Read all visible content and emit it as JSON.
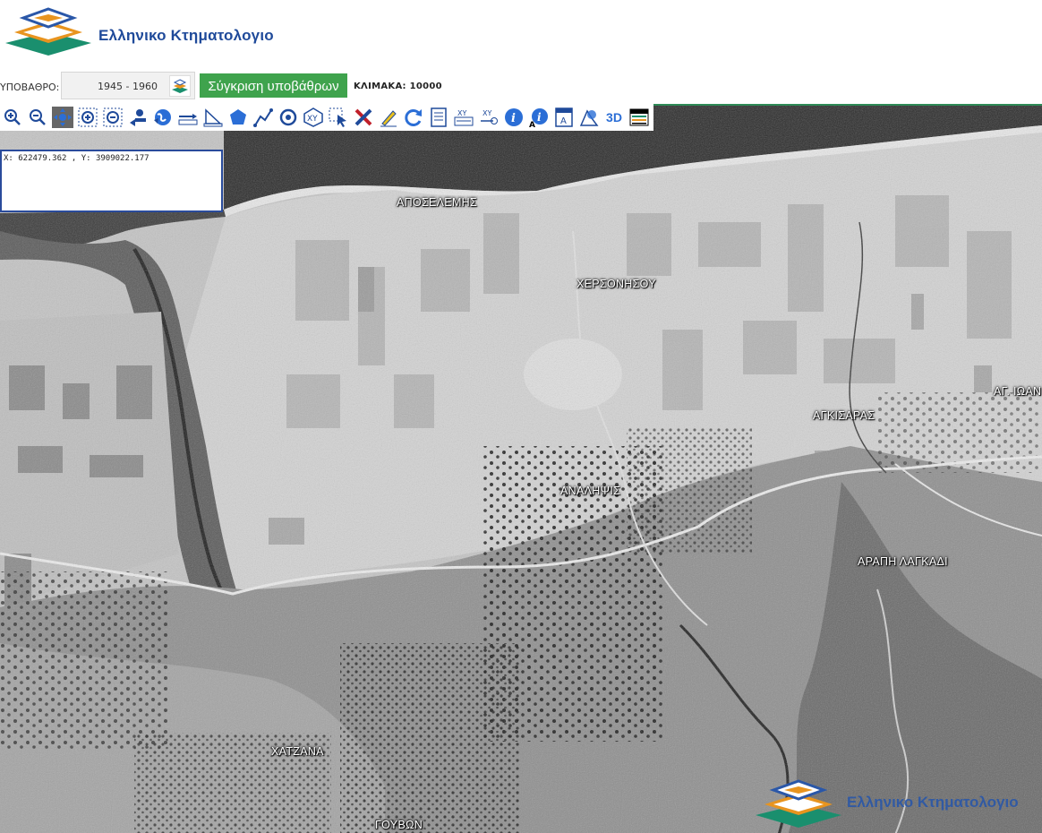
{
  "header": {
    "logo_text": "Ελληνικο Κτηματολογιο"
  },
  "controls": {
    "basemap_label": "ΥΠΟΒΑΘΡΟ:",
    "basemap_value": "1945 - 1960",
    "compare_button": "Σύγκριση υποβάθρων",
    "scale_label": "ΚΛΙΜΑΚΑ: 10000"
  },
  "toolbar": {
    "tools": [
      "zoom-in-icon",
      "zoom-out-icon",
      "pan-icon",
      "zoom-box-in-icon",
      "zoom-box-out-icon",
      "previous-extent-icon",
      "full-extent-icon",
      "measure-distance-icon",
      "measure-area-icon",
      "draw-polygon-icon",
      "draw-line-icon",
      "draw-point-icon",
      "xy-point-icon",
      "select-icon",
      "clear-icon",
      "edit-icon",
      "refresh-icon",
      "legend-icon",
      "xy-list-icon",
      "xy-goto-icon",
      "info-icon",
      "info-text-icon",
      "label-icon",
      "layers-icon",
      "3d-icon",
      "print-icon"
    ],
    "text_3d": "3D",
    "xy_label": "XY"
  },
  "coordinates": {
    "text": "X: 622479.362 , Y: 3909022.177"
  },
  "map": {
    "places": [
      "ΑΠΟΣΕΛΕΜΗΣ",
      "ΧΕΡΣΟΝΗΣΟΥ",
      "ΑΓ. ΙΩΑΝ",
      "ΑΓΚΙΣΑΡΑΣ",
      "ΑΝΑΛΗΨΙΣ",
      "ΑΡΑΠΗ ΛΑΓΚΑΔΙ",
      "ΧΑΤΖΑΝΑ",
      "ΓΟΥΒΩΝ"
    ]
  },
  "watermark": {
    "text": "Ελληνικο Κτηματολογιο"
  },
  "colors": {
    "accent_green": "#3fa34d",
    "brand_blue": "#1f4a9a",
    "logo_orange": "#e8941f",
    "logo_teal": "#1a8f6e"
  }
}
